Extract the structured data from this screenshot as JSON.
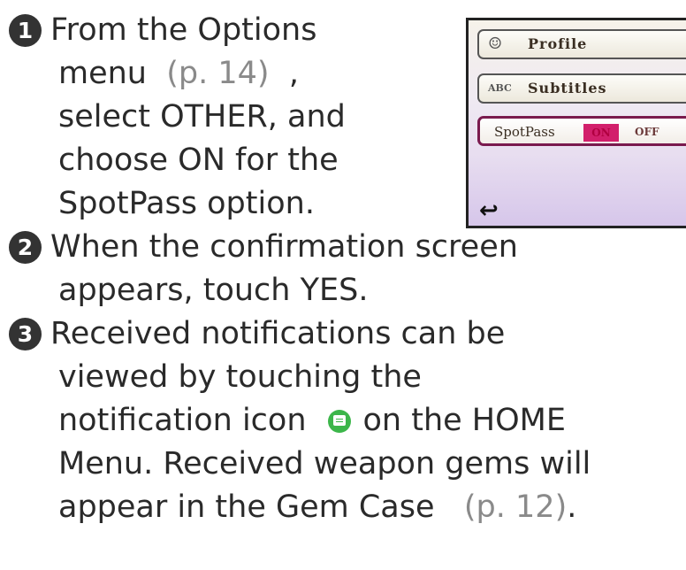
{
  "steps": [
    {
      "number": "1",
      "lines": [
        "From the Options",
        "menu",
        "select OTHER, and",
        "choose ON for the",
        "SpotPass option."
      ],
      "ref": "(p. 14)",
      "ref_after": ","
    },
    {
      "number": "2",
      "lines": [
        "When the confirmation screen",
        "appears, touch YES."
      ]
    },
    {
      "number": "3",
      "lines": [
        "Received notifications can be",
        "viewed by touching the",
        "notification icon",
        "on the HOME",
        "Menu. Received weapon gems will",
        "appear in the Gem Case"
      ],
      "icon": "notification-icon",
      "ref": "(p. 12)",
      "ref_after": "."
    }
  ],
  "options_screen": {
    "items": [
      {
        "icon_text": "☺",
        "label": "Profile"
      },
      {
        "icon_text": "ABC",
        "label": "Subtitles"
      }
    ],
    "spotpass": {
      "label": "SpotPass",
      "on": "ON",
      "off": "OFF"
    },
    "back_icon": "back-arrow-icon",
    "colors": {
      "selected_border": "#7a1a4e",
      "on_highlight": "#d21f6b"
    }
  }
}
